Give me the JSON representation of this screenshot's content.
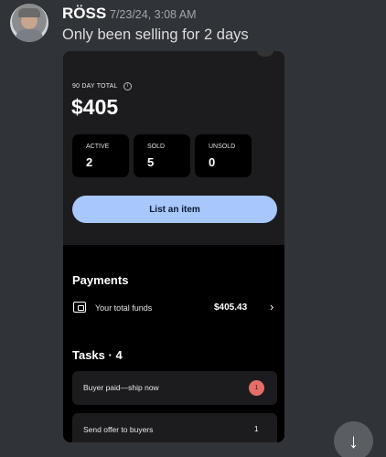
{
  "message": {
    "username": "RÖSS",
    "timestamp": "7/23/24, 3:08 AM",
    "text": "Only been selling for 2 days"
  },
  "screenshot": {
    "stat_title": "90 DAY TOTAL",
    "info_icon": "info-icon",
    "total": "$405",
    "stats": [
      {
        "label": "ACTIVE",
        "value": "2"
      },
      {
        "label": "SOLD",
        "value": "5"
      },
      {
        "label": "UNSOLD",
        "value": "0"
      }
    ],
    "list_button": "List an item",
    "payments": {
      "title": "Payments",
      "funds_label": "Your total funds",
      "funds_value": "$405.43",
      "chevron": "›"
    },
    "tasks": {
      "title": "Tasks · 4",
      "items": [
        {
          "label": "Buyer paid—ship now",
          "count": "1"
        },
        {
          "label": "Send offer to buyers",
          "count": "1"
        }
      ]
    }
  },
  "scroll_button_icon": "↓",
  "colors": {
    "background": "#303338",
    "accent_button": "#a8c7fa",
    "badge": "#e46e6a"
  }
}
